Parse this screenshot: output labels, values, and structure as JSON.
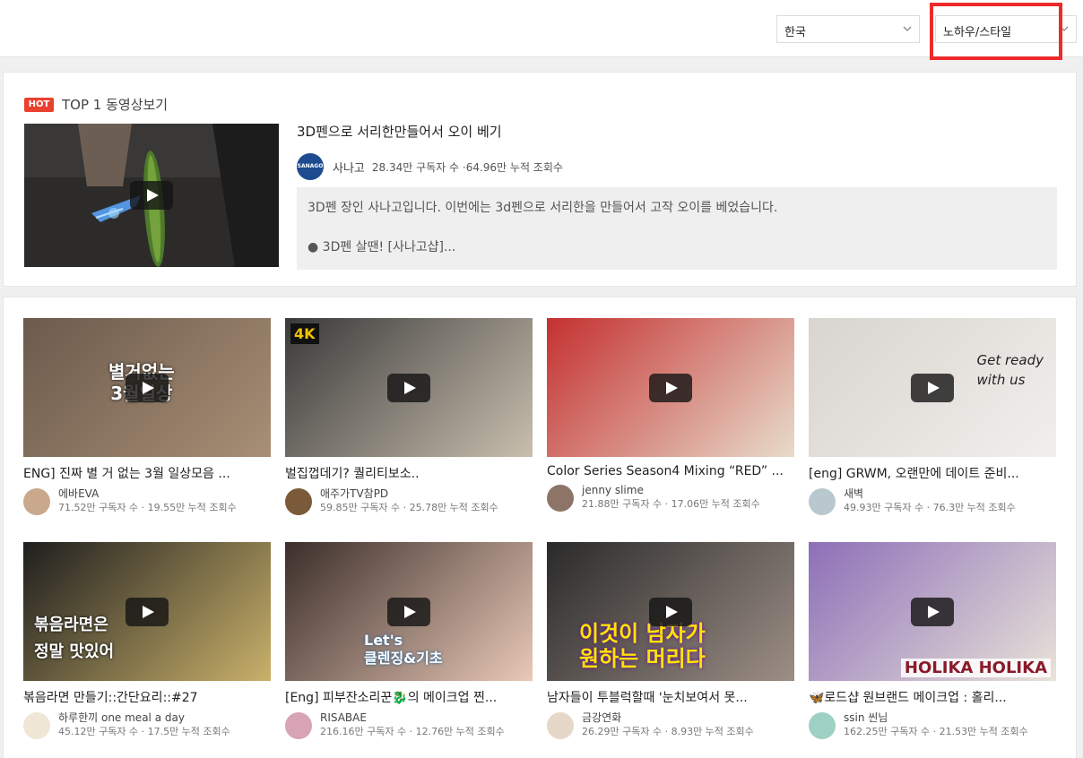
{
  "filters": {
    "country": "한국",
    "category": "노하우/스타일"
  },
  "hot": {
    "badge": "HOT",
    "label": "TOP 1 동영상보기",
    "title": "3D펜으로 서리한만들어서 오이 베기",
    "channel": "사나고",
    "avatar_text": "SANAGO",
    "stats": "28.34만 구독자 수 ·64.96만 누적 조회수",
    "description": "3D펜 장인 사나고입니다. 이번에는 3d펜으로 서리한을 만들어서 고작 오이를 베었습니다.",
    "description_line2": "● 3D펜 살땐! [사나고샵]..."
  },
  "videos": [
    {
      "title": "ENG] 진짜 별 거 없는 3월 일상모음 ...",
      "channel": "에바EVA",
      "stats": "71.52만 구독자 수 · 19.55만 누적 조회수",
      "thumb_text": "별거없는\n3월일상",
      "thumb_colors": [
        "#6b5a4c",
        "#a88f75"
      ],
      "avatar_color": "#c9a88c"
    },
    {
      "title": "벌집껍데기? 퀄리티보소..",
      "channel": "애주가TV참PD",
      "stats": "59.85만 구독자 수 · 25.78만 누적 조회수",
      "thumb_text": "4K",
      "thumb_colors": [
        "#3a3a3a",
        "#c9bfae"
      ],
      "avatar_color": "#7b5a3a"
    },
    {
      "title": "Color Series Season4 Mixing “RED” ...",
      "channel": "jenny slime",
      "stats": "21.88만 구독자 수 · 17.06만 누적 조회수",
      "thumb_text": "",
      "thumb_colors": [
        "#c43030",
        "#e8dccb"
      ],
      "avatar_color": "#8e7466"
    },
    {
      "title": "[eng] GRWM, 오랜만에 데이트 준비...",
      "channel": "새벽",
      "stats": "49.93만 구독자 수 · 76.3만 누적 조회수",
      "thumb_text": "Get ready\nwith us",
      "thumb_colors": [
        "#d8d4cf",
        "#f1efec"
      ],
      "avatar_color": "#b9c7cf"
    },
    {
      "title": "볶음라면 만들기::간단요리::#27",
      "channel": "하루한끼 one meal a day",
      "stats": "45.12만 구독자 수 · 17.5만 누적 조회수",
      "thumb_text": "볶음라면은\n정말 맛있어",
      "thumb_colors": [
        "#1e1e1e",
        "#c9b16a"
      ],
      "avatar_color": "#efe6d6"
    },
    {
      "title": "[Eng] 피부잔소리꾼🐉의 메이크업 찐...",
      "channel": "RISABAE",
      "stats": "216.16만 구독자 수 · 12.76만 누적 조회수",
      "thumb_text": "Let's\n클렌징&기초",
      "thumb_colors": [
        "#3b2e2a",
        "#e9c9b7"
      ],
      "avatar_color": "#d7a3b5"
    },
    {
      "title": "남자들이 투블럭할때 '눈치보여서 못...",
      "channel": "금강연화",
      "stats": "26.29만 구독자 수 · 8.93만 누적 조회수",
      "thumb_text": "이것이 남자가\n원하는 머리다",
      "thumb_colors": [
        "#2a2a2a",
        "#9d8f86"
      ],
      "avatar_color": "#e5d8c8"
    },
    {
      "title": "🦋로드샵 원브랜드 메이크업 : 홀리...",
      "channel": "ssin 씬님",
      "stats": "162.25만 구독자 수 · 21.53만 누적 조회수",
      "thumb_text": "HOLIKA HOLIKA",
      "thumb_colors": [
        "#8d6fb8",
        "#e9e3d8"
      ],
      "avatar_color": "#9fd0c4"
    }
  ],
  "colors": {
    "hot_badge": "#e9412f",
    "highlight_box": "#ee2a2a"
  },
  "icons": {
    "play": "play-icon",
    "chevron": "chevron-down-icon"
  }
}
